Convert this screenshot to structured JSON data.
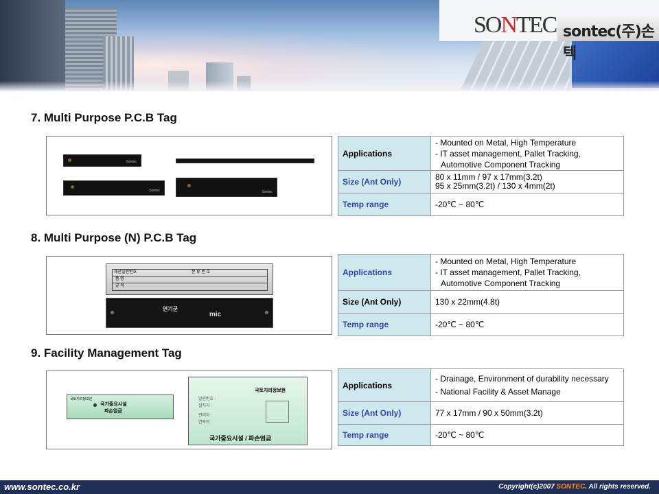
{
  "header": {
    "logo_text_part1": "SO",
    "logo_text_part2": "N",
    "logo_text_part3": "TEC",
    "brand_label": "sontec(주)손텍"
  },
  "sections": [
    {
      "title": "7. Multi Purpose P.C.B Tag",
      "rows": [
        {
          "label": "Applications",
          "lines": [
            "- Mounted on Metal, High Temperature",
            "- IT asset management, Pallet Tracking,",
            "  Automotive Component Tracking"
          ]
        },
        {
          "label": "Size (Ant Only)",
          "lines": [
            "80 x 11mm / 97 x 17mm(3.2t)",
            "95 x 25mm(3.2t) / 130 x 4mm(2t)"
          ]
        },
        {
          "label": "Temp range",
          "lines": [
            "-20℃ ~ 80℃"
          ]
        }
      ],
      "tag_mark": "Sontec"
    },
    {
      "title": "8. Multi Purpose (N) P.C.B Tag",
      "rows": [
        {
          "label": "Applications",
          "lines": [
            "- Mounted on Metal, High Temperature",
            "- IT asset management, Pallet Tracking,",
            "  Automotive Component Tracking"
          ]
        },
        {
          "label": "Size (Ant Only)",
          "lines": [
            "130 x 22mm(4.8t)"
          ]
        },
        {
          "label": "Temp range",
          "lines": [
            "-20℃ ~ 80℃"
          ]
        }
      ],
      "plate_text": {
        "cell1": "재산일련번호",
        "cell2": "분 류 번 호",
        "row2": "품 명",
        "row3": "규 격",
        "logo1": "연기군",
        "logo2": "mic"
      }
    },
    {
      "title": "9. Facility Management Tag",
      "rows": [
        {
          "label": "Applications",
          "lines": [
            "- Drainage, Environment of durability necessary",
            "- National Facility & Asset Manage"
          ]
        },
        {
          "label": "Size (Ant Only)",
          "lines": [
            "77 x 17mm / 90 x 50mm(3.2t)"
          ]
        },
        {
          "label": "Temp range",
          "lines": [
            "-20℃ ~ 80℃"
          ]
        }
      ],
      "plate_text": {
        "small_header": "국토지리정보원",
        "small_title1": "국가중요시설",
        "small_title2": "파손엄금",
        "big_header": "국토지리정보원",
        "big_line1": "일련번호 :",
        "big_line2": "설치자 :",
        "big_line3": "관리자 :",
        "big_line4": "연락처 :",
        "big_footer": "국가중요시설 / 파손엄금"
      }
    }
  ],
  "footer": {
    "url": "www.sontec.co.kr",
    "copy_prefix": "Copyright(c)2007 ",
    "copy_brand": "SONTEC",
    "copy_suffix": ". All rights reserved."
  },
  "colors": {
    "label_bg": "#cfe8ee",
    "label_blue": "#3344aa",
    "footer_bg": "#1f2f55",
    "brand_orange": "#ff8a1a"
  }
}
